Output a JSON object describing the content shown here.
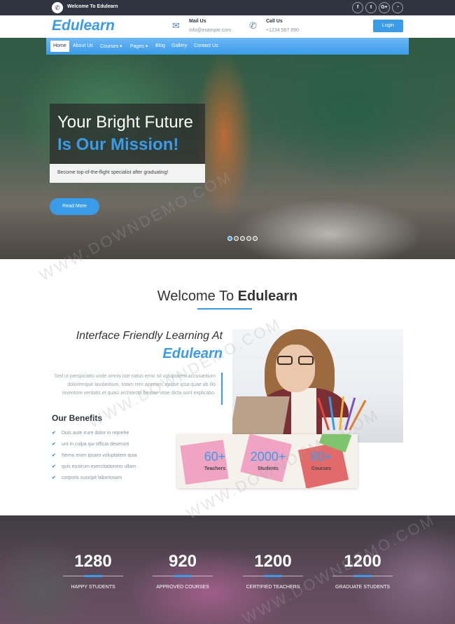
{
  "topbar": {
    "welcome": "Welcome To Edulearn",
    "socials": [
      {
        "icon": "facebook-icon",
        "glyph": "f"
      },
      {
        "icon": "twitter-icon",
        "glyph": "t"
      },
      {
        "icon": "google-plus-icon",
        "glyph": "G+"
      },
      {
        "icon": "rss-icon",
        "glyph": "◔"
      }
    ]
  },
  "header": {
    "logo": "Edulearn",
    "mail": {
      "label": "Mail Us",
      "value": "info@example.com"
    },
    "call": {
      "label": "Call Us",
      "value": "+1234 567 890"
    },
    "login": "Login"
  },
  "nav": {
    "items": [
      "Home",
      "About Us",
      "Courses ▾",
      "Pages ▾",
      "Blog",
      "Gallery",
      "Contact Us"
    ]
  },
  "hero": {
    "line1": "Your Bright Future",
    "line2": "Is Our Mission!",
    "subtitle": "Become top-of-the-flight specialist after graduating!",
    "cta": "Read More",
    "slides": 5,
    "active_slide": 0
  },
  "welcome": {
    "title_part1": "Welcome To ",
    "title_part2": "Edulearn",
    "heading1": "Interface Friendly Learning At",
    "heading2": "Edulearn",
    "paragraph": "Sed ut perspiciatis unde omnis iste natus error sit voluptatem accusantium doloremque laudantium, totam rem aperiam, eaque ipsa quae ab illo inventore veritatis et quasi architecto beatae vitae dicta sunt explicabo.",
    "benefits_title": "Our Benefits",
    "benefits": [
      "Duis aute irure dolor in reprehe",
      "unt in culpa qui officia deserunt",
      "Nemo enim ipsam voluptatem quia",
      "quis nostrum exercitationem ullam",
      "corporis suscipit laboriosam"
    ]
  },
  "stats": [
    {
      "value": "60+",
      "label": "Teachers"
    },
    {
      "value": "2000+",
      "label": "Students"
    },
    {
      "value": "80+",
      "label": "Courses"
    }
  ],
  "counters": [
    {
      "value": "1280",
      "label": "HAPPY STUDENTS"
    },
    {
      "value": "920",
      "label": "APPROVED COURSES"
    },
    {
      "value": "1200",
      "label": "CERTIFIED TEACHERS"
    },
    {
      "value": "1200",
      "label": "GRADUATE STUDENTS"
    }
  ],
  "watermark": "WWW.DOWNDEMO.COM",
  "colors": {
    "accent": "#3a9be8",
    "dark": "#2f3440"
  }
}
